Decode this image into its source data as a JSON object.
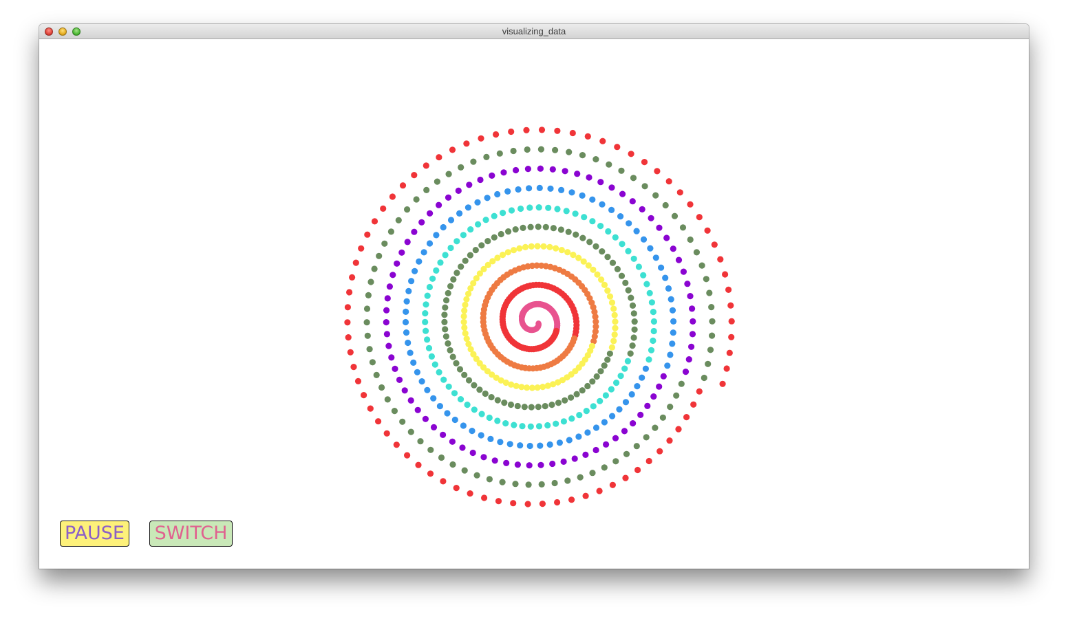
{
  "window": {
    "title": "visualizing_data"
  },
  "controls": {
    "pause": {
      "label": "PAUSE",
      "text_color": "#8b5fc7",
      "bg_color": "#fdf17a"
    },
    "switch": {
      "label": "SWITCH",
      "text_color": "#e0618f",
      "bg_color": "#c9e8b8"
    }
  },
  "visualization": {
    "type": "spiral-dots",
    "turns": 10,
    "dot_count": 780,
    "palette": [
      "#e8538f",
      "#f03438",
      "#ee7b43",
      "#fbf256",
      "#6a8c5e",
      "#3de0d2",
      "#3594ec",
      "#8a04d1"
    ],
    "ring_colors": [
      "#e8538f",
      "#f03438",
      "#ee7b43",
      "#fbf256",
      "#6a8c5e",
      "#3de0d2",
      "#3594ec",
      "#8a04d1",
      "#6a8c5e",
      "#f03438",
      "#e8538f"
    ]
  }
}
